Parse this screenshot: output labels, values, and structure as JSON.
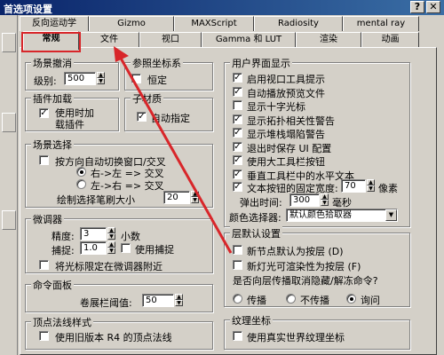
{
  "window": {
    "title": "首选项设置",
    "help_button": "?",
    "close_button": "✕"
  },
  "tabs_top": [
    "反向运动学",
    "Gizmo",
    "MAXScript",
    "Radiosity",
    "mental ray"
  ],
  "tabs_bottom": [
    "常规",
    "文件",
    "视口",
    "Gamma 和 LUT",
    "渲染",
    "动画"
  ],
  "scene_undo": {
    "title": "场景撤消",
    "levels_label": "级别:",
    "levels_value": "500"
  },
  "ref_coord": {
    "title": "参照坐标系",
    "constant_label": "恒定"
  },
  "plugin_load": {
    "title": "插件加载",
    "load_on_demand_label": "使用时加载插件"
  },
  "sub_material": {
    "title": "子材质",
    "auto_assign_label": "自动指定"
  },
  "scene_select": {
    "title": "场景选择",
    "auto_switch_label": "按方向自动切换窗口/交叉",
    "right_left_label": "右->左 => 交叉",
    "left_right_label": "左->右 => 交叉",
    "brush_size_label": "绘制选择笔刷大小",
    "brush_size_value": "20"
  },
  "spinners": {
    "title": "微调器",
    "precision_label": "精度:",
    "precision_value": "3",
    "decimals_label": "小数",
    "snap_label": "捕捉:",
    "snap_value": "1.0",
    "use_snap_label": "使用捕捉",
    "wrap_cursor_label": "将光标限定在微调器附近"
  },
  "command_panel": {
    "title": "命令面板",
    "rollup_threshold_label": "卷展栏阈值:",
    "rollup_threshold_value": "50"
  },
  "vertex_normals": {
    "title": "顶点法线样式",
    "legacy_r4_label": "使用旧版本 R4 的顶点法线"
  },
  "ui_display": {
    "title": "用户界面显示",
    "items": [
      {
        "label": "启用视口工具提示",
        "checked": "✓"
      },
      {
        "label": "自动播放预览文件",
        "checked": "✓"
      },
      {
        "label": "显示十字光标",
        "checked": ""
      },
      {
        "label": "显示拓扑相关性警告",
        "checked": "✓"
      },
      {
        "label": "显示堆栈塌陷警告",
        "checked": "✓"
      },
      {
        "label": "退出时保存 UI 配置",
        "checked": "✓"
      },
      {
        "label": "使用大工具栏按钮",
        "checked": "✓"
      },
      {
        "label": "垂直工具栏中的水平文本",
        "checked": "✓"
      }
    ],
    "fixed_width_label": "文本按钮的固定宽度:",
    "fixed_width_value": "70",
    "pixels_label": "像素",
    "flyout_time_label": "弹出时间:",
    "flyout_time_value": "300",
    "ms_label": "毫秒",
    "color_picker_label": "颜色选择器:",
    "color_picker_value": "默认颜色拾取器"
  },
  "layer_defaults": {
    "title": "层默认设置",
    "new_nodes_label": "新节点默认为按层 (D)",
    "new_lights_label": "新灯光可渲染性为按层 (F)",
    "propagate_question": "是否向层传播取消隐藏/解冻命令?",
    "propagate_label": "传播",
    "no_propagate_label": "不传播",
    "ask_label": "询问"
  },
  "texture_coords": {
    "title": "纹理坐标",
    "real_world_label": "使用真实世界纹理坐标"
  },
  "colors": {
    "annotation_red": "#d8262a",
    "titlebar_start": "#0a246a",
    "titlebar_end": "#3a6ea5"
  }
}
